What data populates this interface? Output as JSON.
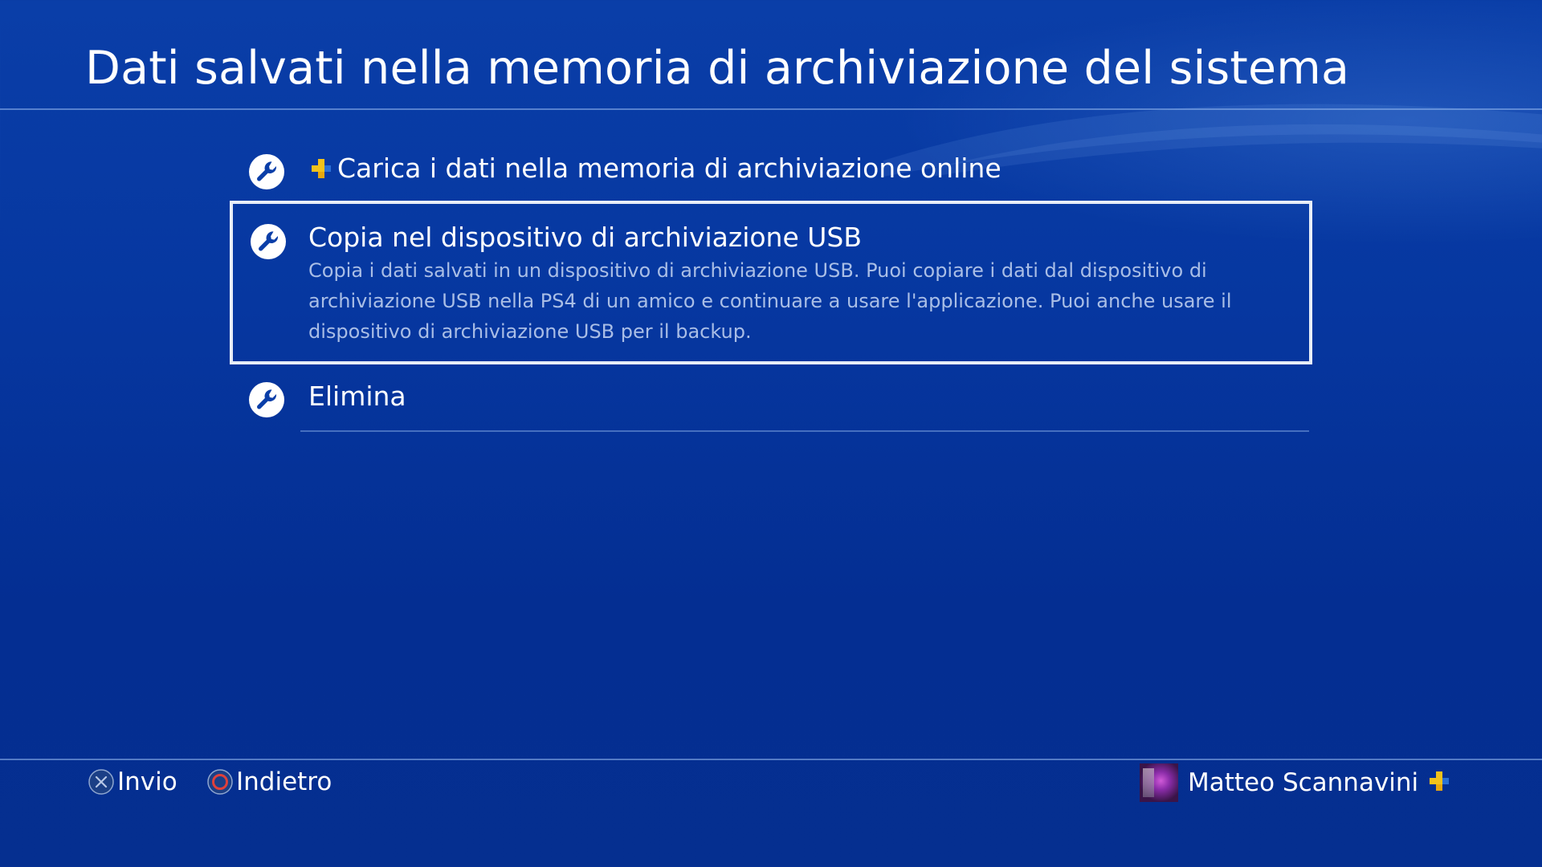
{
  "page": {
    "title": "Dati salvati nella memoria di archiviazione del sistema"
  },
  "menu": {
    "items": [
      {
        "label": "Carica i dati nella memoria di archiviazione online",
        "icon": "wrench-icon",
        "badge": "psplus-icon",
        "selected": false
      },
      {
        "label": "Copia nel dispositivo di archiviazione USB",
        "description": "Copia i dati salvati in un dispositivo di archiviazione USB. Puoi copiare i dati dal dispositivo di archiviazione USB nella PS4 di un amico e continuare a usare l'applicazione. Puoi anche usare il dispositivo di archiviazione USB per il backup.",
        "icon": "wrench-icon",
        "selected": true
      },
      {
        "label": "Elimina",
        "icon": "wrench-icon",
        "selected": false
      }
    ]
  },
  "footer": {
    "enter_label": "Invio",
    "enter_icon": "cross-button-icon",
    "back_label": "Indietro",
    "back_icon": "circle-button-icon",
    "user_name": "Matteo Scannavini",
    "user_badge": "psplus-icon"
  },
  "colors": {
    "background": "#0637a0",
    "text": "#ffffff",
    "description": "#cddcf5",
    "selection_border": "#e8eef8",
    "psplus_gold": "#f2c21b",
    "circle_button": "#e0403a"
  }
}
